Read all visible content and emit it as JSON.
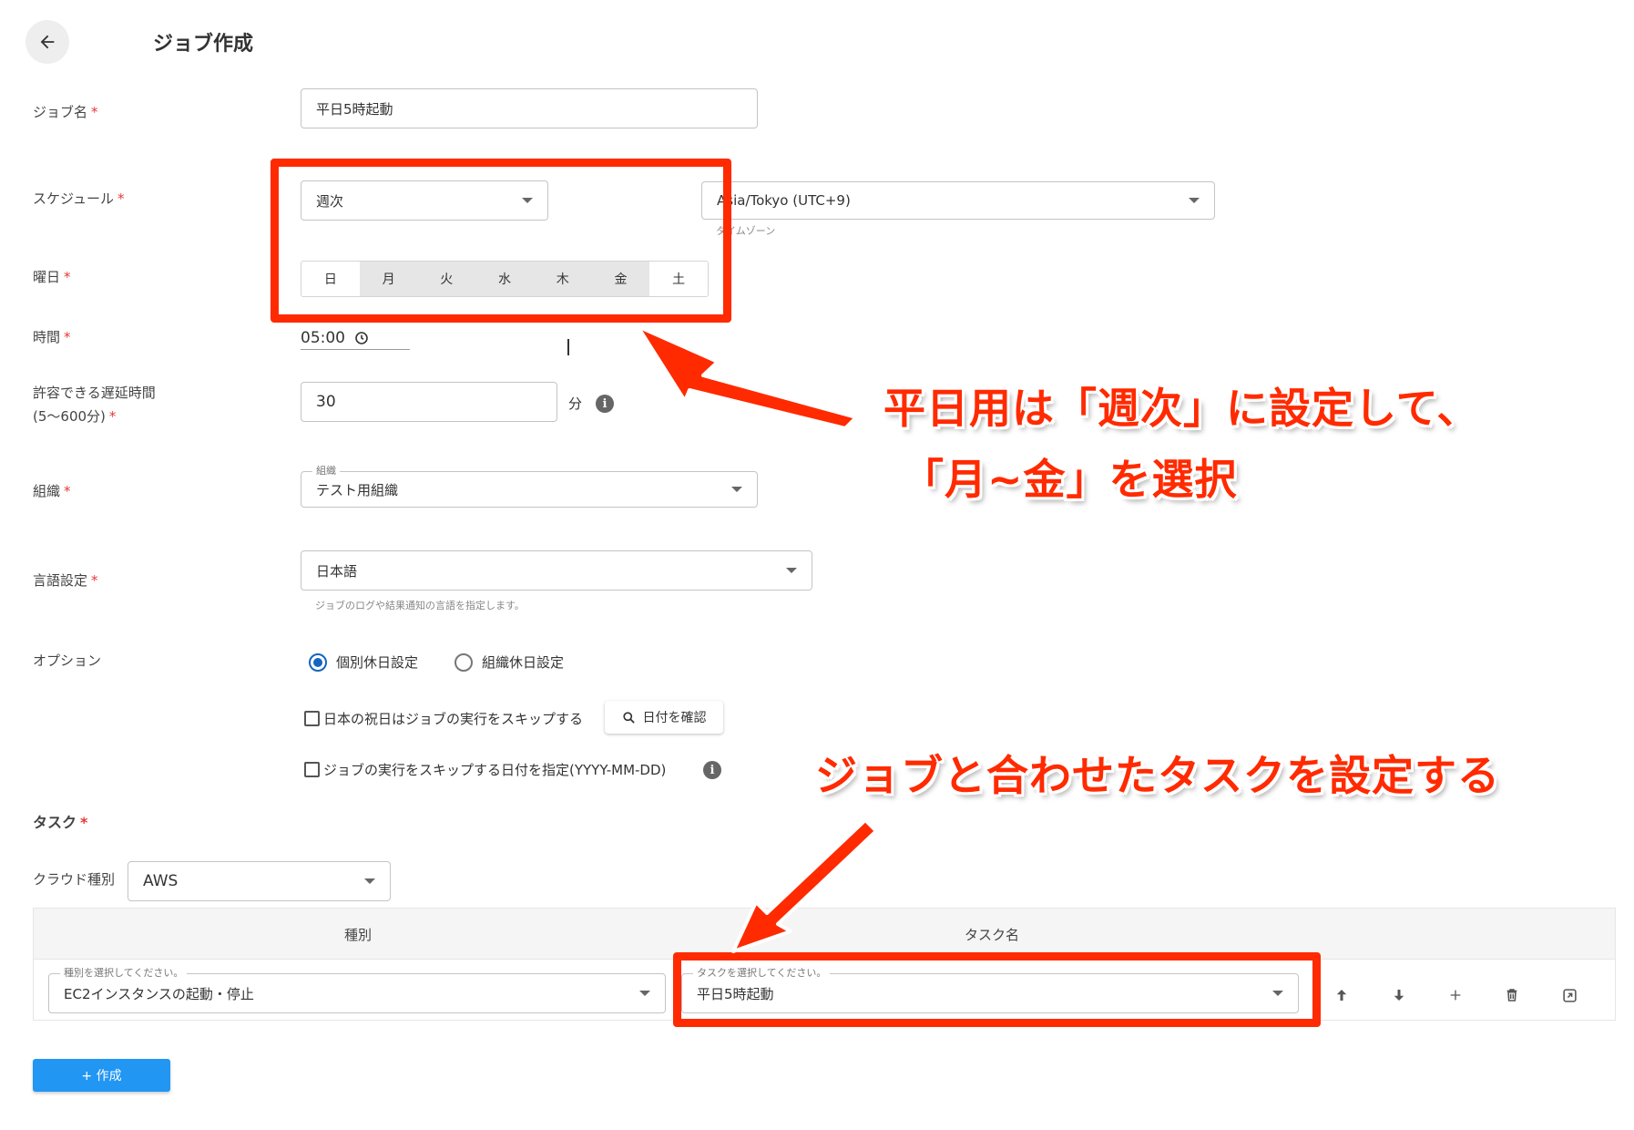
{
  "header": {
    "title": "ジョブ作成"
  },
  "form": {
    "job_name": {
      "label": "ジョブ名",
      "required": "*",
      "value": "平日5時起動"
    },
    "schedule": {
      "label": "スケジュール",
      "required": "*",
      "value": "週次"
    },
    "timezone": {
      "value": "Asia/Tokyo (UTC+9)",
      "helper": "タイムゾーン"
    },
    "weekday": {
      "label": "曜日",
      "required": "*",
      "days": [
        {
          "label": "日",
          "selected": false
        },
        {
          "label": "月",
          "selected": true
        },
        {
          "label": "火",
          "selected": true
        },
        {
          "label": "水",
          "selected": true
        },
        {
          "label": "木",
          "selected": true
        },
        {
          "label": "金",
          "selected": true
        },
        {
          "label": "土",
          "selected": false
        }
      ]
    },
    "time": {
      "label": "時間",
      "required": "*",
      "value": "05:00"
    },
    "delay": {
      "label_line1": "許容できる遅延時間",
      "label_line2": "(5〜600分)",
      "required": "*",
      "value": "30",
      "unit": "分"
    },
    "organization": {
      "label": "組織",
      "required": "*",
      "float_label": "組織",
      "value": "テスト用組織"
    },
    "language": {
      "label": "言語設定",
      "required": "*",
      "value": "日本語",
      "helper": "ジョブのログや結果通知の言語を指定します。"
    },
    "option": {
      "label": "オプション",
      "radio_individual": "個別休日設定",
      "radio_org": "組織休日設定",
      "skip_holidays": "日本の祝日はジョブの実行をスキップする",
      "check_dates_button": "日付を確認",
      "skip_dates": "ジョブの実行をスキップする日付を指定(YYYY-MM-DD)"
    }
  },
  "tasks": {
    "label": "タスク",
    "required": "*",
    "cloud_label": "クラウド種別",
    "cloud_value": "AWS",
    "table": {
      "col_type": "種別",
      "col_name": "タスク名",
      "row": {
        "type_float_label": "種別を選択してください。",
        "type_value": "EC2インスタンスの起動・停止",
        "name_float_label": "タスクを選択してください。",
        "name_value": "平日5時起動"
      }
    },
    "create_button": "+ 作成"
  },
  "annotations": {
    "callout1_line1": "平日用は「週次」に設定して、",
    "callout1_line2": "「月~金」を選択",
    "callout2": "ジョブと合わせたタスクを設定する",
    "color": "#ff2a00"
  },
  "colors": {
    "primary": "#2196f3",
    "radio": "#1565c0",
    "required": "#e53935"
  }
}
